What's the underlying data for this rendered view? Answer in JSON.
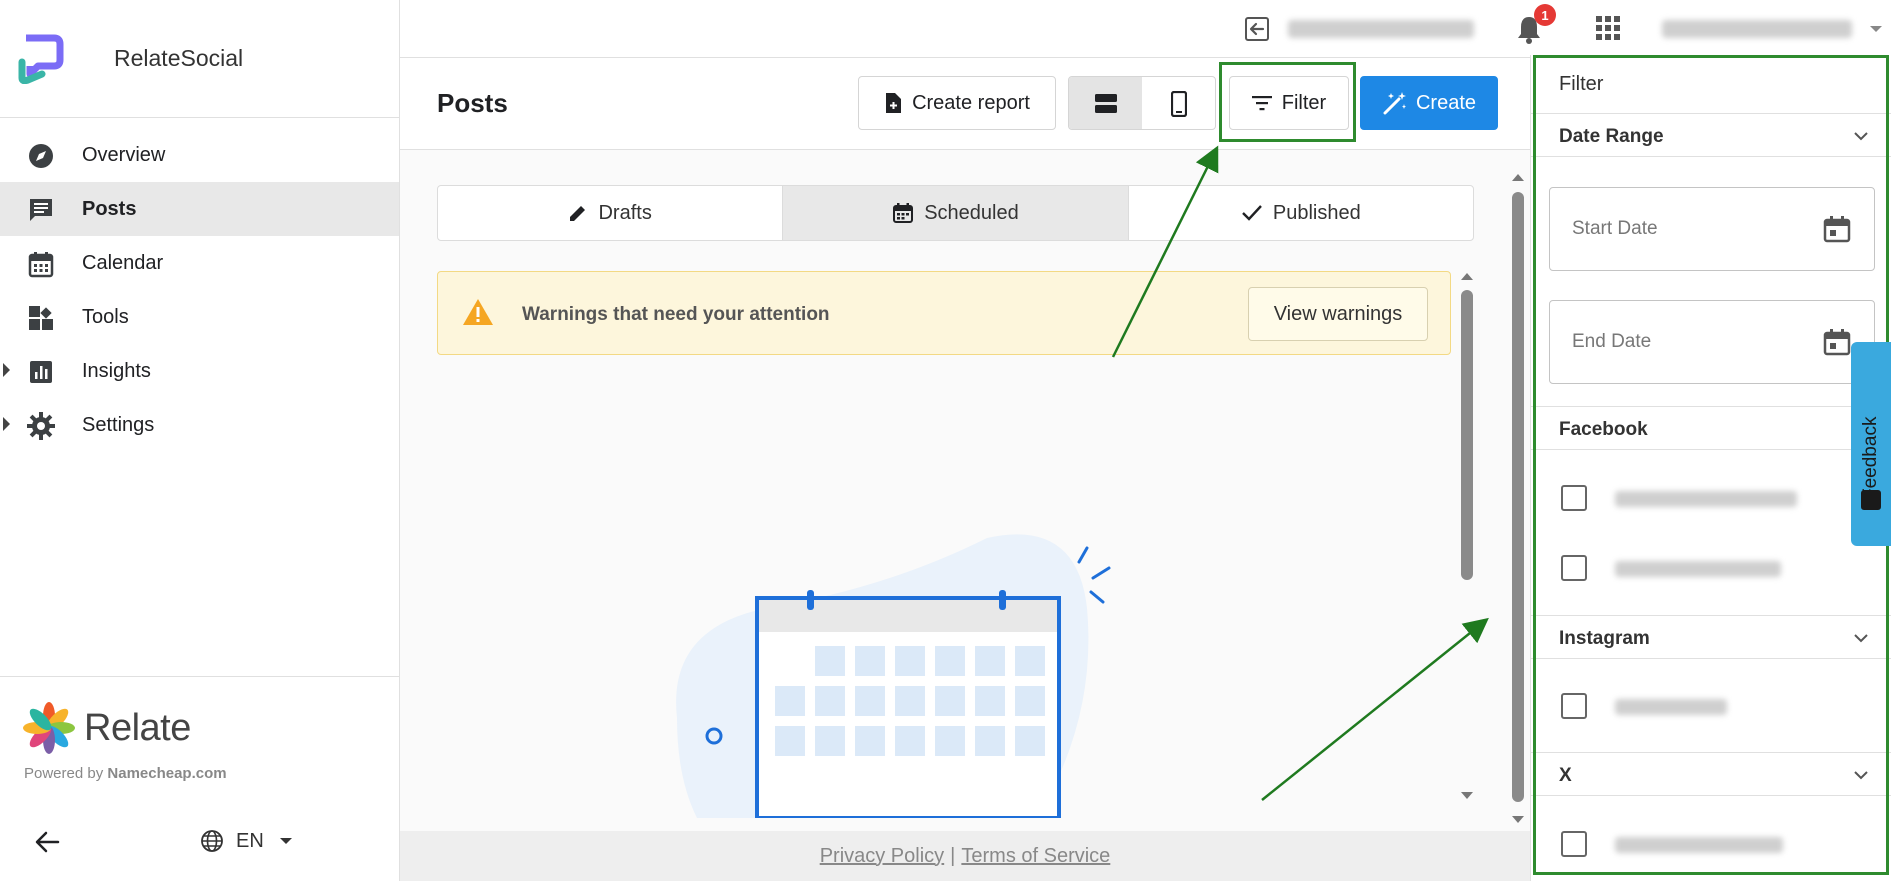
{
  "app": {
    "name": "RelateSocial"
  },
  "sidebar": {
    "items": [
      {
        "label": "Overview",
        "icon": "compass-icon"
      },
      {
        "label": "Posts",
        "icon": "posts-icon",
        "active": true
      },
      {
        "label": "Calendar",
        "icon": "calendar-icon"
      },
      {
        "label": "Tools",
        "icon": "tools-icon"
      },
      {
        "label": "Insights",
        "icon": "insights-icon",
        "expandable": true
      },
      {
        "label": "Settings",
        "icon": "gear-icon",
        "expandable": true
      }
    ],
    "footer": {
      "brand": "Relate",
      "powered_prefix": "Powered by ",
      "powered_by": "Namecheap.com",
      "language": "EN"
    }
  },
  "topbar": {
    "notification_count": "1"
  },
  "header": {
    "title": "Posts",
    "create_report_label": "Create report",
    "filter_label": "Filter",
    "create_label": "Create"
  },
  "tabs": [
    {
      "label": "Drafts",
      "icon": "pencil-icon"
    },
    {
      "label": "Scheduled",
      "icon": "calendar-icon",
      "selected": true
    },
    {
      "label": "Published",
      "icon": "check-icon"
    }
  ],
  "warning": {
    "text": "Warnings that need your attention",
    "button": "View warnings"
  },
  "footer": {
    "privacy": "Privacy Policy",
    "separator": "|",
    "terms": "Terms of Service"
  },
  "filter_panel": {
    "title": "Filter",
    "date_range": {
      "label": "Date Range",
      "start_placeholder": "Start Date",
      "end_placeholder": "End Date"
    },
    "sections": [
      {
        "label": "Facebook"
      },
      {
        "label": "Instagram"
      },
      {
        "label": "X"
      }
    ]
  },
  "feedback": {
    "label": "Feedback"
  },
  "colors": {
    "primary": "#1e88e5",
    "highlight": "#2e8b2e",
    "warning_bg": "#fdf6dc",
    "warning_icon": "#f5a623",
    "badge": "#e53935",
    "feedback": "#3aa9de"
  }
}
